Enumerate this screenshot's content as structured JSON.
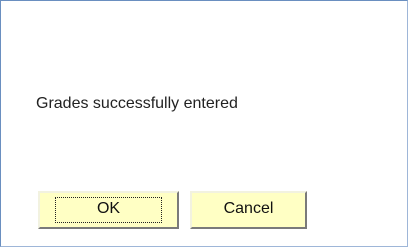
{
  "dialog": {
    "message": "Grades successfully entered",
    "ok_label": "OK",
    "cancel_label": "Cancel"
  },
  "colors": {
    "button_bg": "#ffffc4",
    "dialog_border": "#6a8fc0",
    "text": "#222222"
  }
}
